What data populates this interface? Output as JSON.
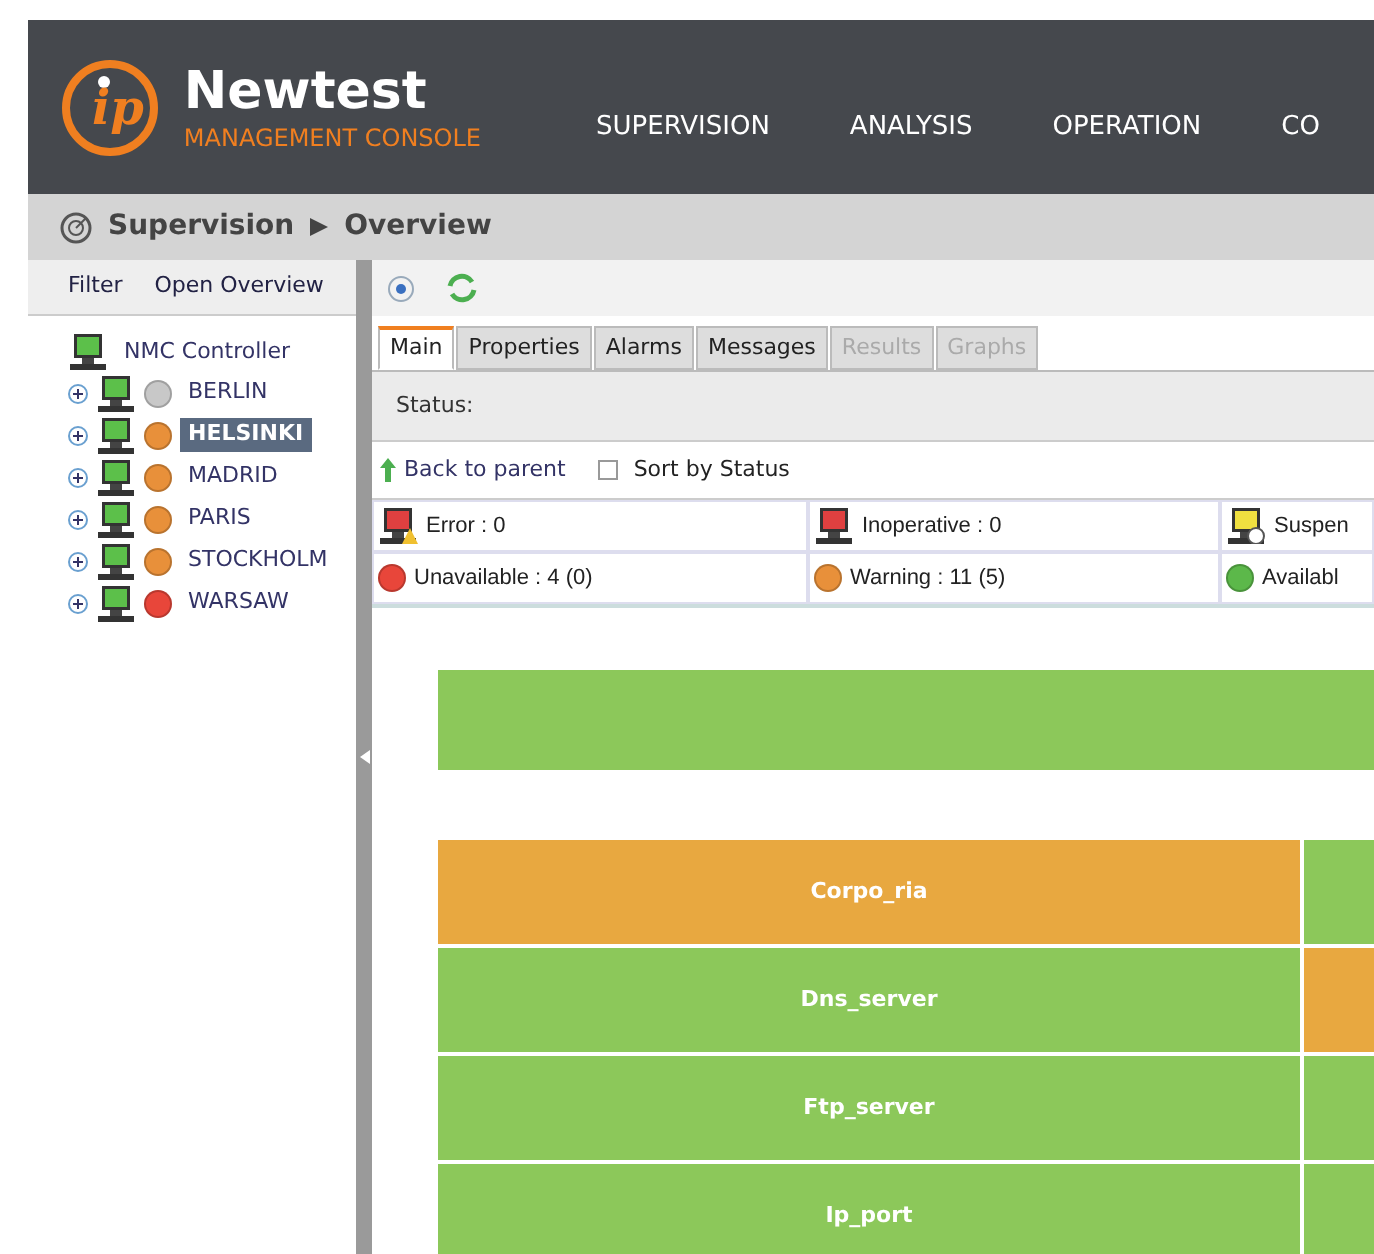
{
  "brand": {
    "name": "Newtest",
    "subtitle": "MANAGEMENT CONSOLE",
    "logo_letters": "ip"
  },
  "nav": [
    {
      "label": "SUPERVISION"
    },
    {
      "label": "ANALYSIS"
    },
    {
      "label": "OPERATION"
    },
    {
      "label": "CO"
    }
  ],
  "breadcrumb": [
    "Supervision",
    "Overview"
  ],
  "sidebar": {
    "filter": "Filter",
    "open_overview": "Open Overview",
    "root": "NMC Controller",
    "items": [
      {
        "label": "BERLIN",
        "color": "#c8c8c8",
        "selected": false
      },
      {
        "label": "HELSINKI",
        "color": "#e8903a",
        "selected": true
      },
      {
        "label": "MADRID",
        "color": "#e8903a",
        "selected": false
      },
      {
        "label": "PARIS",
        "color": "#e8903a",
        "selected": false
      },
      {
        "label": "STOCKHOLM",
        "color": "#e8903a",
        "selected": false
      },
      {
        "label": "WARSAW",
        "color": "#e8463a",
        "selected": false
      }
    ]
  },
  "tabs": [
    {
      "label": "Main",
      "selected": true,
      "disabled": false
    },
    {
      "label": "Properties",
      "selected": false,
      "disabled": false
    },
    {
      "label": "Alarms",
      "selected": false,
      "disabled": false
    },
    {
      "label": "Messages",
      "selected": false,
      "disabled": false
    },
    {
      "label": "Results",
      "selected": false,
      "disabled": true
    },
    {
      "label": "Graphs",
      "selected": false,
      "disabled": true
    }
  ],
  "status_label": "Status:",
  "back_to_parent": "Back to parent",
  "sort_by_status": {
    "label": "Sort by Status",
    "checked": false
  },
  "summary": [
    {
      "label": "Error : 0",
      "kind": "error"
    },
    {
      "label": "Inoperative : 0",
      "kind": "inoperative"
    },
    {
      "label": "Suspen",
      "kind": "suspended"
    },
    {
      "label": "Unavailable : 4 (0)",
      "kind": "red"
    },
    {
      "label": "Warning : 11 (5)",
      "kind": "orange"
    },
    {
      "label": "Availabl",
      "kind": "green"
    }
  ],
  "treemap": {
    "top": {
      "color": "#8cc85a"
    },
    "rows": [
      {
        "label": "Corpo_ria",
        "color": "#e8a840",
        "side": {
          "color": "#8cc85a"
        }
      },
      {
        "label": "Dns_server",
        "color": "#8cc85a",
        "side": {
          "color": "#e8a840"
        }
      },
      {
        "label": "Ftp_server",
        "color": "#8cc85a",
        "side": {
          "color": "#8cc85a"
        }
      },
      {
        "label": "Ip_port",
        "color": "#8cc85a",
        "side": {
          "color": "#8cc85a"
        }
      }
    ]
  }
}
